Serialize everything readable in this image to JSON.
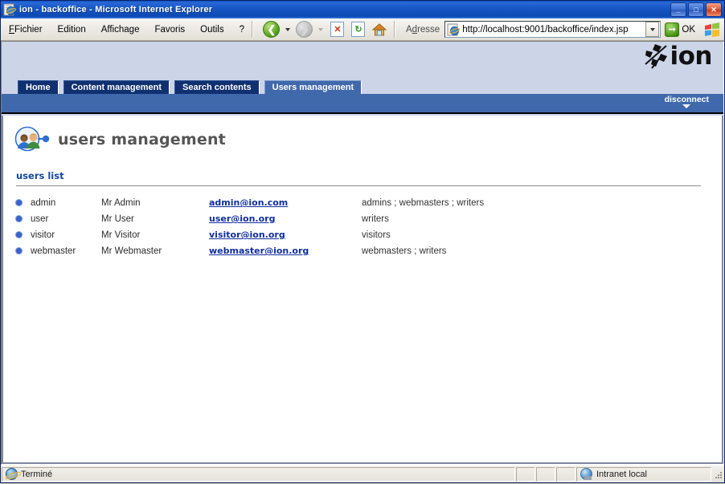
{
  "window": {
    "title": "ion - backoffice - Microsoft Internet Explorer",
    "minimize_label": "_",
    "maximize_label": "□",
    "close_label": "✕"
  },
  "menubar": {
    "items": [
      {
        "label": "Fichier",
        "accel": "F"
      },
      {
        "label": "Edition",
        "accel": "E"
      },
      {
        "label": "Affichage",
        "accel": "A"
      },
      {
        "label": "Favoris",
        "accel": "v"
      },
      {
        "label": "Outils",
        "accel": "O"
      },
      {
        "label": "?",
        "accel": ""
      }
    ]
  },
  "toolbar": {
    "back": "Back",
    "forward": "Forward",
    "stop": "Stop",
    "refresh": "Refresh",
    "home": "Home"
  },
  "address": {
    "label": "Adresse",
    "value": "http://localhost:9001/backoffice/index.jsp",
    "placeholder": "http://",
    "go_label": "OK"
  },
  "app": {
    "brand": "ion",
    "disconnect_label": "disconnect",
    "tabs": [
      {
        "label": "Home",
        "active": false
      },
      {
        "label": "Content management",
        "active": false
      },
      {
        "label": "Search contents",
        "active": false
      },
      {
        "label": "Users management",
        "active": true
      }
    ],
    "page_title": "users management",
    "section_label": "users list"
  },
  "users_table": {
    "rows": [
      {
        "login": "admin",
        "display_name": "Mr Admin",
        "email": "admin@ion.com",
        "groups": "admins ; webmasters ; writers"
      },
      {
        "login": "user",
        "display_name": "Mr User",
        "email": "user@ion.org",
        "groups": "writers"
      },
      {
        "login": "visitor",
        "display_name": "Mr Visitor",
        "email": "visitor@ion.org",
        "groups": "visitors"
      },
      {
        "login": "webmaster",
        "display_name": "Mr Webmaster",
        "email": "webmaster@ion.org",
        "groups": "webmasters ; writers"
      }
    ]
  },
  "statusbar": {
    "status": "Terminé",
    "zone": "Intranet local"
  },
  "colors": {
    "title_bar": "#1858c4",
    "app_band": "#ccd5e8",
    "tab_inactive": "#103070",
    "tab_active": "#4069ab",
    "blue_bar": "#4069ab",
    "link": "#102e9e",
    "section_heading": "#14479e",
    "page_title": "#555555",
    "bullet": "#3b63c8"
  }
}
